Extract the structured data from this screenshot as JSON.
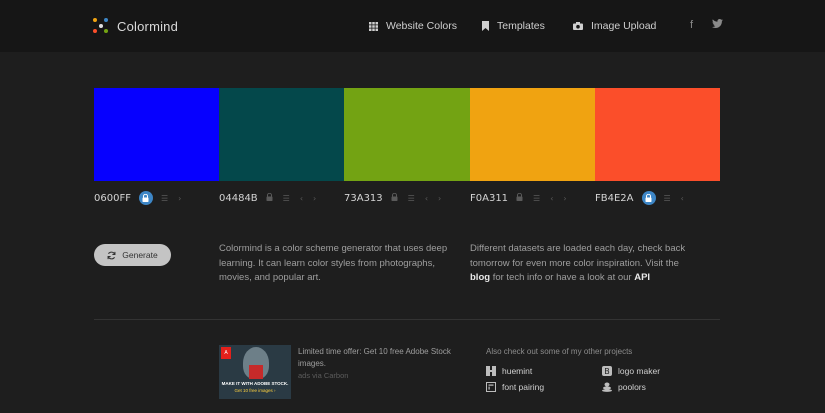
{
  "header": {
    "brand": "Colormind",
    "nav": [
      {
        "label": "Website Colors",
        "icon": "grid-icon"
      },
      {
        "label": "Templates",
        "icon": "bookmark-icon"
      },
      {
        "label": "Image Upload",
        "icon": "camera-icon"
      }
    ],
    "social": [
      {
        "label": "f",
        "icon": "facebook-icon"
      },
      {
        "label": "🐦",
        "icon": "twitter-icon"
      }
    ]
  },
  "palette": [
    {
      "hex": "0600FF",
      "color": "#0600FF",
      "locked": true
    },
    {
      "hex": "04484B",
      "color": "#04484B",
      "locked": false
    },
    {
      "hex": "73A313",
      "color": "#73A313",
      "locked": false
    },
    {
      "hex": "F0A311",
      "color": "#F0A311",
      "locked": false
    },
    {
      "hex": "FB4E2A",
      "color": "#FB4E2A",
      "locked": true
    }
  ],
  "generate_label": "Generate",
  "description": {
    "left": "Colormind is a color scheme generator that uses deep learning. It can learn color styles from photographs, movies, and popular art.",
    "right_part1": "Different datasets are loaded each day, check back tomorrow for even more color inspiration. Visit the ",
    "right_link1": "blog",
    "right_part2": " for tech info or have a look at our ",
    "right_link2": "API"
  },
  "ad": {
    "text": "Limited time offer: Get 10 free Adobe Stock images.",
    "via": "ads via Carbon",
    "image_caption": "MAKE IT WITH ADOBE STOCK.",
    "image_subcaption": "Get 10 free images ›",
    "image_brand": "Adobe"
  },
  "projects": {
    "title": "Also check out some of my other projects",
    "items": [
      {
        "label": "huemint",
        "icon": "huemint-icon"
      },
      {
        "label": "logo maker",
        "icon": "logo-maker-icon"
      },
      {
        "label": "font pairing",
        "icon": "font-pairing-icon"
      },
      {
        "label": "poolors",
        "icon": "poolors-icon"
      }
    ]
  },
  "colors": {
    "background": "#1e1e1e",
    "header": "#161616",
    "lock_active": "#3d86c6"
  }
}
